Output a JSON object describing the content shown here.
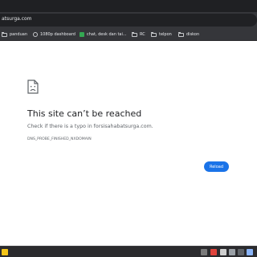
{
  "browser": {
    "url": "atsurga.com",
    "bookmarks": [
      {
        "label": "panduan",
        "icon": "folder-icon"
      },
      {
        "label": "1080p dashboard",
        "icon": "globe-icon"
      },
      {
        "label": "chat, desk dan tai...",
        "icon": "leaf-icon"
      },
      {
        "label": "RC",
        "icon": "folder-icon"
      },
      {
        "label": "telpon",
        "icon": "folder-icon"
      },
      {
        "label": "diskon",
        "icon": "folder-icon"
      }
    ]
  },
  "error_page": {
    "title": "This site can’t be reached",
    "description": "Check if there is a typo in forsisahabatsurga.com.",
    "error_code": "DNS_PROBE_FINISHED_NXDOMAIN",
    "reload_label": "Reload"
  },
  "taskbar": {
    "icons": [
      "yellow-app-icon",
      "app-icon",
      "red-app-icon",
      "app-icon",
      "app-icon",
      "app-icon",
      "app-icon",
      "app-icon"
    ]
  },
  "colors": {
    "accent": "#1a73e8",
    "browser_bg": "#35363a",
    "text": "#202124",
    "muted": "#5f6368"
  }
}
